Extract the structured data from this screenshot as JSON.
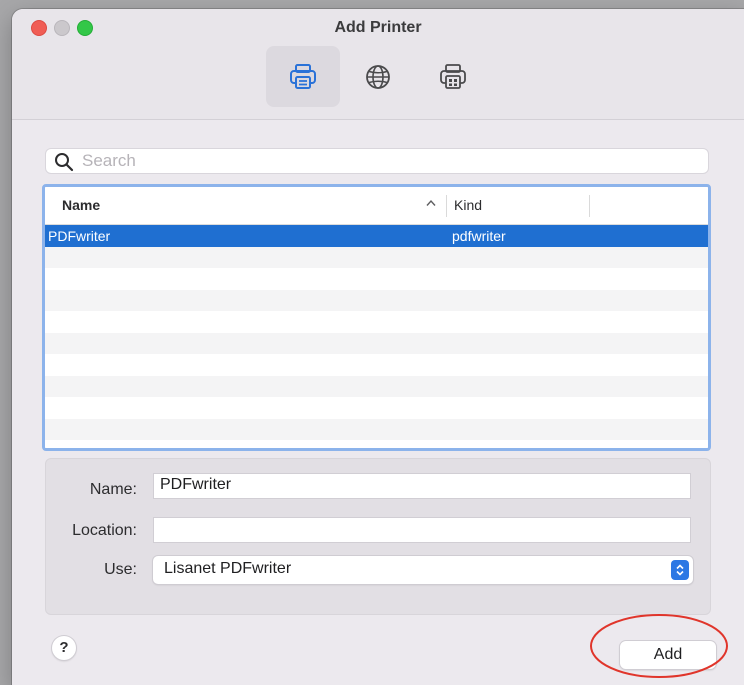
{
  "window": {
    "title": "Add Printer"
  },
  "toolbar": {
    "tools": [
      {
        "icon": "default-printer-icon",
        "selected": true
      },
      {
        "icon": "globe-ip-icon",
        "selected": false
      },
      {
        "icon": "windows-printer-icon",
        "selected": false
      }
    ]
  },
  "search": {
    "placeholder": "Search"
  },
  "table": {
    "columns": {
      "name": "Name",
      "kind": "Kind"
    },
    "sort_indicator": "^",
    "rows": [
      {
        "name": "PDFwriter",
        "kind": "pdfwriter",
        "selected": true
      }
    ]
  },
  "form": {
    "name_label": "Name:",
    "name_value": "PDFwriter",
    "location_label": "Location:",
    "location_value": "",
    "use_label": "Use:",
    "use_value": "Lisanet PDFwriter"
  },
  "buttons": {
    "help": "?",
    "add": "Add"
  },
  "colors": {
    "selection": "#1f6fd1",
    "focus_ring": "#8cb3eb",
    "annotation": "#e0352b"
  }
}
